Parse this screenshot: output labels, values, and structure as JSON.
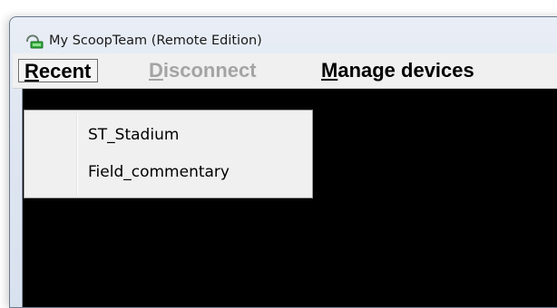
{
  "window": {
    "title": "My ScoopTeam (Remote Edition)",
    "icon": "scoopteam-app-icon"
  },
  "menubar": {
    "recent": {
      "mnemonic": "R",
      "rest": "ecent",
      "state": "open"
    },
    "disconnect": {
      "mnemonic": "D",
      "rest": "isconnect",
      "state": "disabled"
    },
    "manage_devices": {
      "mnemonic": "M",
      "rest": "anage devices",
      "state": "enabled"
    }
  },
  "recent_menu": {
    "items": [
      "ST_Stadium",
      "Field_commentary"
    ]
  },
  "colors": {
    "client_background": "#000000",
    "menubar_background": "#f0f0f0",
    "disabled_text": "#a4a4a4",
    "app_icon_green": "#2fa83a"
  }
}
